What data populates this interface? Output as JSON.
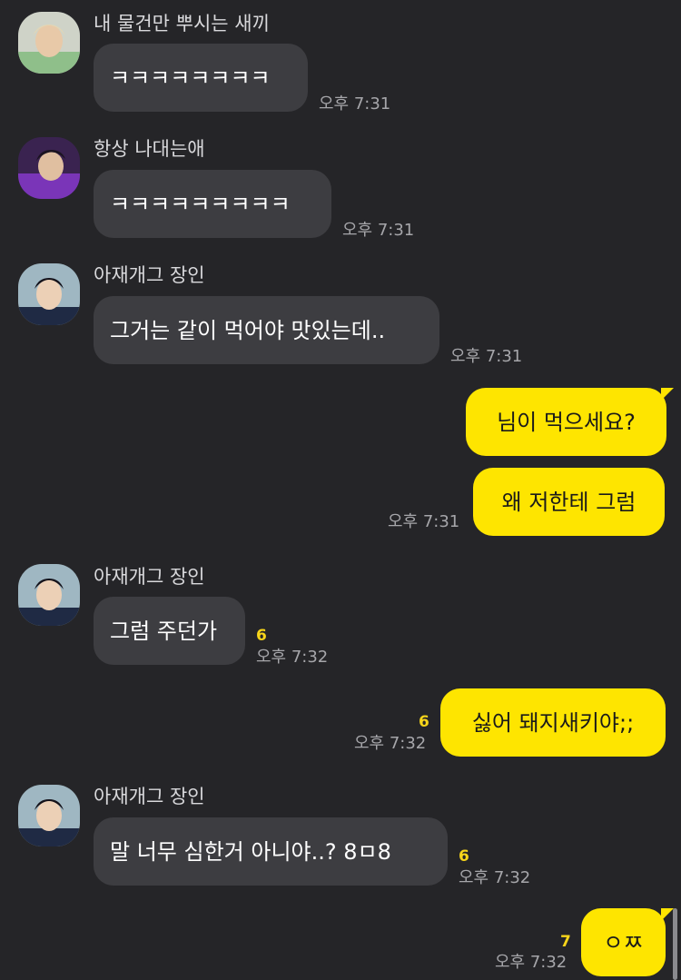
{
  "messages": [
    {
      "sender": "내 물건만 뿌시는 새끼",
      "text": "ㅋㅋㅋㅋㅋㅋㅋㅋ",
      "time": "오후 7:31"
    },
    {
      "sender": "항상 나대는애",
      "text": "ㅋㅋㅋㅋㅋㅋㅋㅋㅋ",
      "time": "오후 7:31"
    },
    {
      "sender": "아재개그 장인",
      "text": "그거는 같이 먹어야 맛있는데..",
      "time": "오후 7:31"
    },
    {
      "text": "님이 먹으세요?"
    },
    {
      "text": "왜 저한테 그럼",
      "time": "오후 7:31"
    },
    {
      "sender": "아재개그 장인",
      "text": "그럼 주던가",
      "unread": "6",
      "time": "오후 7:32"
    },
    {
      "text": "싫어 돼지새키야;;",
      "unread": "6",
      "time": "오후 7:32"
    },
    {
      "sender": "아재개그 장인",
      "text": "말 너무 심한거 아니야..? 8ㅁ8",
      "unread": "6",
      "time": "오후 7:32"
    },
    {
      "text": "ㅇㅉ",
      "unread": "7",
      "time": "오후 7:32"
    }
  ],
  "colors": {
    "background": "#252528",
    "incoming_bubble": "#3d3d41",
    "outgoing_bubble": "#fee500",
    "unread": "#f7d51a"
  }
}
